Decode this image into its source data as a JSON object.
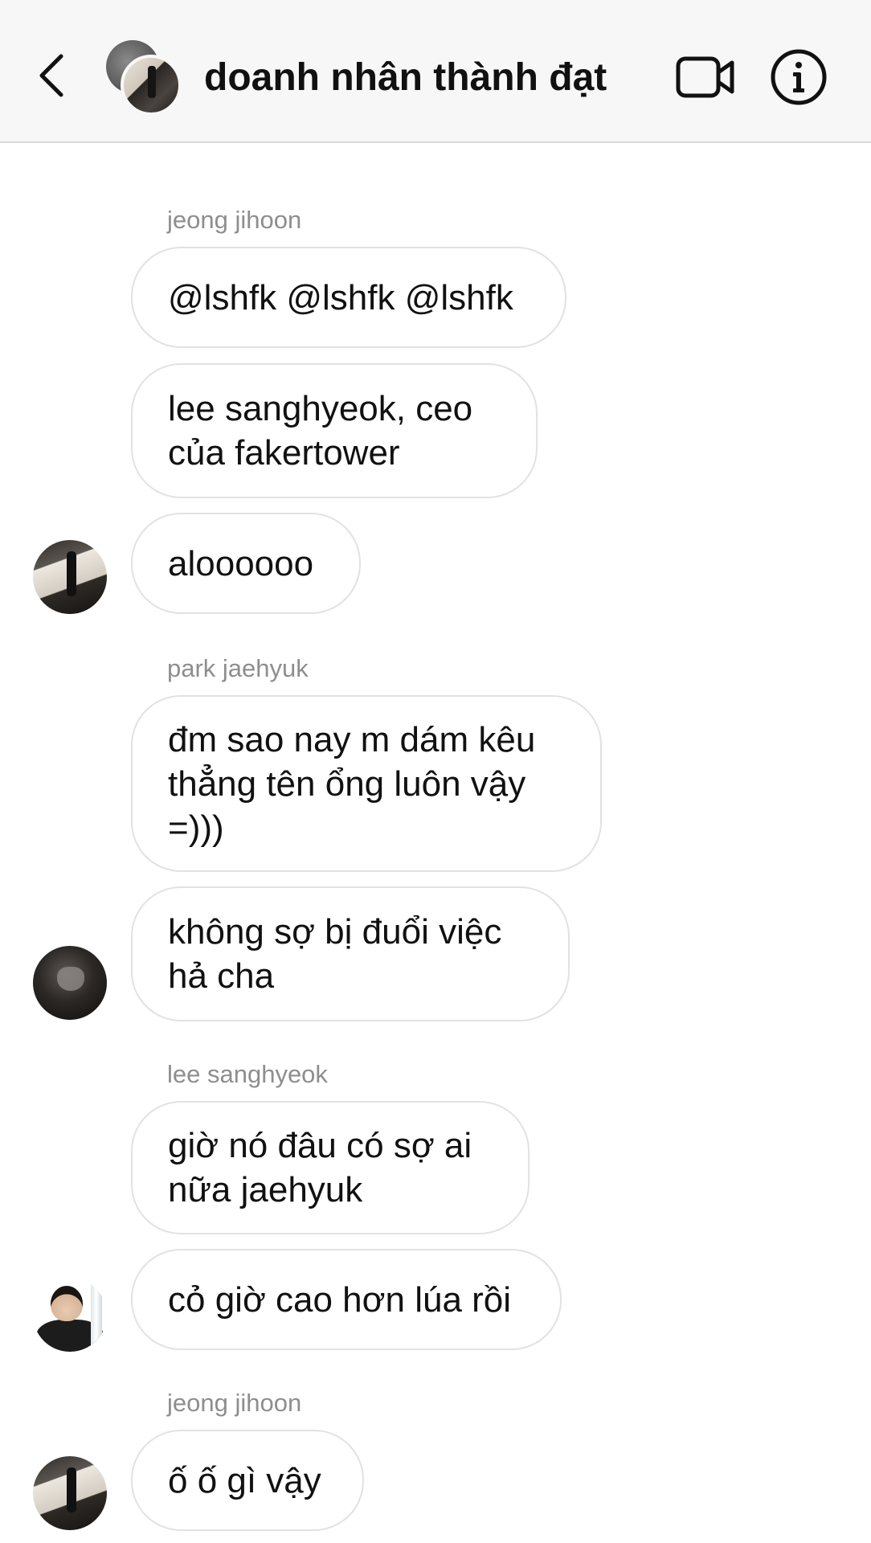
{
  "header": {
    "title": "doanh nhân thành đạt",
    "back_icon": "chevron-left-icon",
    "video_icon": "video-camera-icon",
    "info_icon": "info-icon"
  },
  "messages": [
    {
      "sender": "jeong jihoon",
      "texts": [
        "@lshfk @lshfk @lshfk",
        "lee sanghyeok, ceo\ncủa fakertower",
        "aloooooo"
      ]
    },
    {
      "sender": "park jaehyuk",
      "texts": [
        "đm sao nay m dám kêu\nthẳng tên ổng luôn vậy\n=)))",
        "không sợ bị đuổi việc\nhả cha"
      ]
    },
    {
      "sender": "lee sanghyeok",
      "texts": [
        "giờ nó đâu có sợ ai\nnữa jaehyuk",
        "cỏ giờ cao hơn lúa rồi"
      ]
    },
    {
      "sender": "jeong jihoon",
      "texts": [
        "ố ố gì vậy"
      ]
    }
  ],
  "colors": {
    "header_bg": "#f7f7f7",
    "bubble_border": "#e2e2e2",
    "sender_name": "#8e8e8e",
    "text": "#111111"
  }
}
